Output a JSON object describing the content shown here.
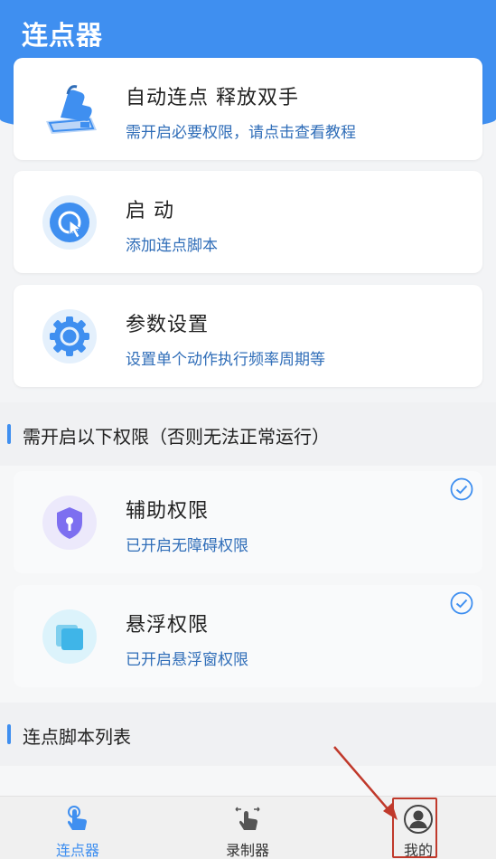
{
  "header": {
    "title": "连点器"
  },
  "cards": {
    "auto": {
      "title": "自动连点 释放双手",
      "sub_prefix": "需开启必要权限，请点击",
      "sub_link": "查看教程"
    },
    "start": {
      "title": "启 动",
      "sub": "添加连点脚本"
    },
    "settings": {
      "title": "参数设置",
      "sub": "设置单个动作执行频率周期等"
    }
  },
  "permissions_section": {
    "label": "需开启以下权限（否则无法正常运行）",
    "items": [
      {
        "title": "辅助权限",
        "sub": "已开启无障碍权限"
      },
      {
        "title": "悬浮权限",
        "sub": "已开启悬浮窗权限"
      }
    ]
  },
  "scripts_section": {
    "label": "连点脚本列表"
  },
  "tabbar": {
    "tabs": [
      {
        "label": "连点器",
        "icon": "tap-hand-icon",
        "active": true
      },
      {
        "label": "录制器",
        "icon": "swipe-hand-icon",
        "active": false
      },
      {
        "label": "我的",
        "icon": "user-avatar-icon",
        "active": false
      }
    ]
  },
  "colors": {
    "accent": "#3f8ff0",
    "annotation": "#c0392b"
  }
}
